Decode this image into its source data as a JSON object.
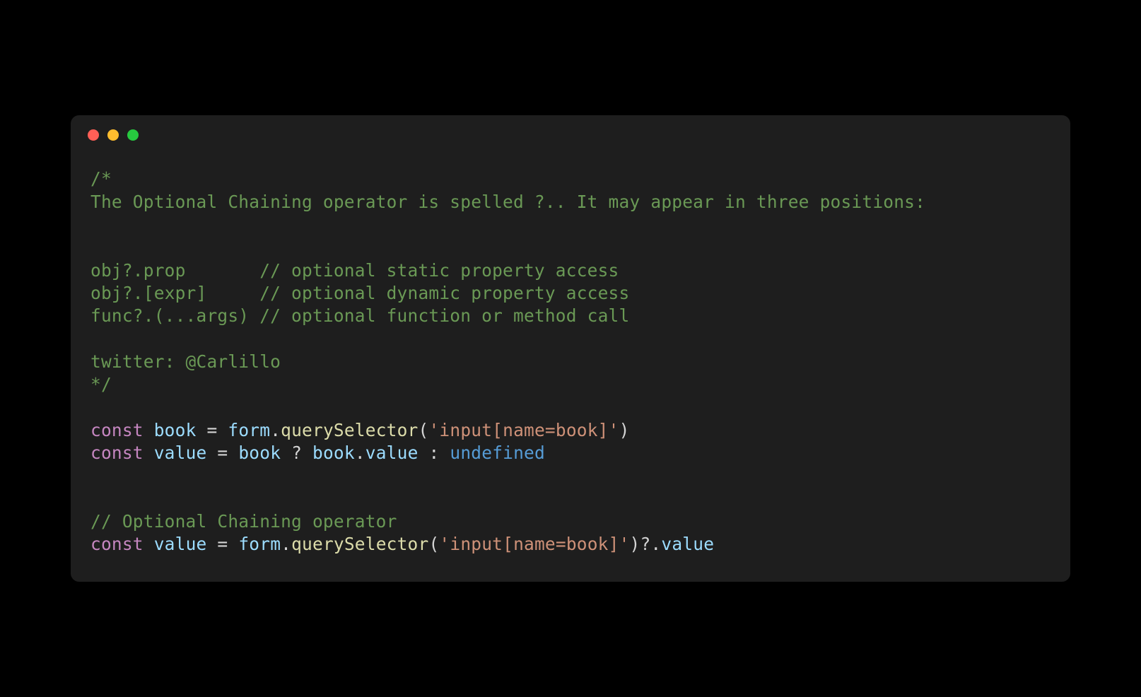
{
  "comment": {
    "l1": "/*",
    "l2": "The Optional Chaining operator is spelled ?.. It may appear in three positions:",
    "l3": "",
    "l4": "",
    "l5": "obj?.prop       // optional static property access",
    "l6": "obj?.[expr]     // optional dynamic property access",
    "l7": "func?.(...args) // optional function or method call",
    "l8": "",
    "l9": "twitter: @Carlillo",
    "l10": "*/"
  },
  "code1": {
    "kw1": "const",
    "var1": "book",
    "eq": " = ",
    "obj1": "form",
    "dot": ".",
    "fn1": "querySelector",
    "lp": "(",
    "str1": "'input[name=book]'",
    "rp": ")",
    "kw2": "const",
    "var2": "value",
    "eq2": " = ",
    "obj2": "book",
    "q": " ? ",
    "obj3": "book",
    "dot2": ".",
    "prop": "value",
    "colon": " : ",
    "undef": "undefined"
  },
  "comment2": "// Optional Chaining operator",
  "code2": {
    "kw": "const",
    "var": "value",
    "eq": " = ",
    "obj": "form",
    "dot": ".",
    "fn": "querySelector",
    "lp": "(",
    "str": "'input[name=book]'",
    "rp": ")",
    "opt": "?.",
    "prop": "value"
  }
}
